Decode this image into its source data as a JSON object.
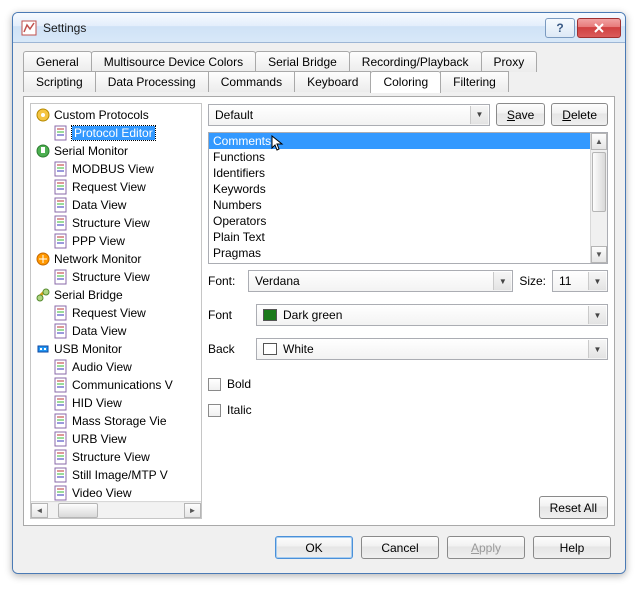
{
  "window": {
    "title": "Settings"
  },
  "tabs_row1": [
    "General",
    "Multisource Device Colors",
    "Serial Bridge",
    "Recording/Playback",
    "Proxy"
  ],
  "tabs_row2": [
    "Scripting",
    "Data Processing",
    "Commands",
    "Keyboard",
    "Coloring",
    "Filtering"
  ],
  "active_tab": "Coloring",
  "tree": [
    {
      "label": "Custom Protocols",
      "icon": "gear-yellow",
      "indent": 0
    },
    {
      "label": "Protocol Editor",
      "icon": "doc",
      "indent": 1,
      "selected": true
    },
    {
      "label": "Serial Monitor",
      "icon": "plug-green",
      "indent": 0
    },
    {
      "label": "MODBUS View",
      "icon": "doc",
      "indent": 1
    },
    {
      "label": "Request View",
      "icon": "doc",
      "indent": 1
    },
    {
      "label": "Data View",
      "icon": "doc",
      "indent": 1
    },
    {
      "label": "Structure View",
      "icon": "doc",
      "indent": 1
    },
    {
      "label": "PPP View",
      "icon": "doc",
      "indent": 1
    },
    {
      "label": "Network Monitor",
      "icon": "net-orange",
      "indent": 0
    },
    {
      "label": "Structure View",
      "icon": "doc",
      "indent": 1
    },
    {
      "label": "Serial Bridge",
      "icon": "link-yellow",
      "indent": 0
    },
    {
      "label": "Request View",
      "icon": "doc",
      "indent": 1
    },
    {
      "label": "Data View",
      "icon": "doc",
      "indent": 1
    },
    {
      "label": "USB Monitor",
      "icon": "usb-blue",
      "indent": 0
    },
    {
      "label": "Audio View",
      "icon": "doc",
      "indent": 1
    },
    {
      "label": "Communications V",
      "icon": "doc",
      "indent": 1
    },
    {
      "label": "HID View",
      "icon": "doc",
      "indent": 1
    },
    {
      "label": "Mass Storage Vie",
      "icon": "doc",
      "indent": 1
    },
    {
      "label": "URB View",
      "icon": "doc",
      "indent": 1
    },
    {
      "label": "Structure View",
      "icon": "doc",
      "indent": 1
    },
    {
      "label": "Still Image/MTP V",
      "icon": "doc",
      "indent": 1
    },
    {
      "label": "Video View",
      "icon": "doc",
      "indent": 1
    }
  ],
  "scheme": {
    "value": "Default",
    "save": "Save",
    "delete": "Delete"
  },
  "tokens": [
    "Comments",
    "Functions",
    "Identifiers",
    "Keywords",
    "Numbers",
    "Operators",
    "Plain Text",
    "Pragmas"
  ],
  "token_selected": 0,
  "font": {
    "label": "Font:",
    "value": "Verdana",
    "size_label": "Size:",
    "size_value": "11"
  },
  "font_color": {
    "label": "Font",
    "value": "Dark green",
    "swatch": "#1a7a1a"
  },
  "back_color": {
    "label": "Back",
    "value": "White",
    "swatch": "#ffffff"
  },
  "bold": {
    "label": "Bold",
    "checked": false
  },
  "italic": {
    "label": "Italic",
    "checked": false
  },
  "reset_all": "Reset All",
  "buttons": {
    "ok": "OK",
    "cancel": "Cancel",
    "apply": "Apply",
    "help": "Help"
  }
}
